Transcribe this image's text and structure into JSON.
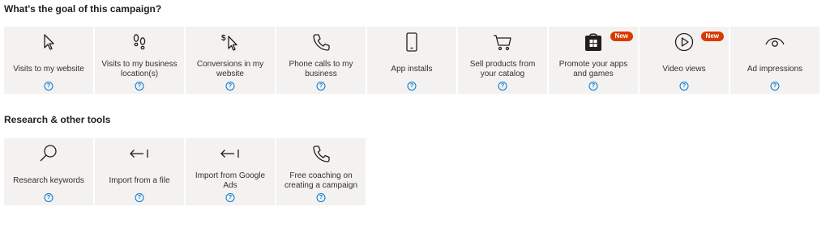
{
  "goal_heading": "What's the goal of this campaign?",
  "goals": [
    {
      "label": "Visits to my website",
      "icon": "cursor-icon"
    },
    {
      "label": "Visits to my business location(s)",
      "icon": "footsteps-icon"
    },
    {
      "label": "Conversions in my website",
      "icon": "dollar-cursor-icon"
    },
    {
      "label": "Phone calls to my business",
      "icon": "phone-icon"
    },
    {
      "label": "App installs",
      "icon": "mobile-icon"
    },
    {
      "label": "Sell products from your catalog",
      "icon": "cart-icon"
    },
    {
      "label": "Promote your apps and games",
      "icon": "store-icon",
      "badge": "New"
    },
    {
      "label": "Video views",
      "icon": "play-icon",
      "badge": "New"
    },
    {
      "label": "Ad impressions",
      "icon": "eye-icon"
    }
  ],
  "tools_heading": "Research & other tools",
  "tools": [
    {
      "label": "Research keywords",
      "icon": "magnifier-icon"
    },
    {
      "label": "Import from a file",
      "icon": "import-icon"
    },
    {
      "label": "Import from Google Ads",
      "icon": "import-icon"
    },
    {
      "label": "Free coaching on creating a campaign",
      "icon": "phone-icon"
    }
  ],
  "help_glyph": "?",
  "colors": {
    "tile_bg": "#f3f2f1",
    "accent": "#0078d4",
    "badge": "#d83b01"
  }
}
